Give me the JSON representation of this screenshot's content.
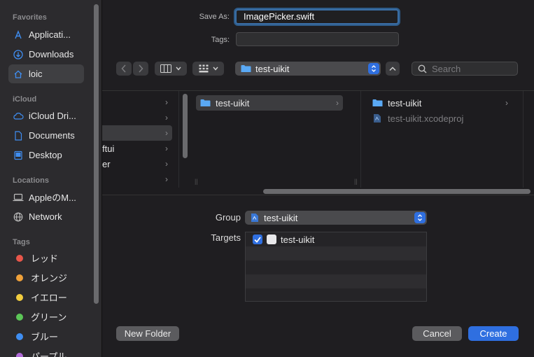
{
  "sidebar": {
    "favorites_heading": "Favorites",
    "favorites": [
      {
        "label": "Applicati...",
        "icon": "applications-icon"
      },
      {
        "label": "Downloads",
        "icon": "downloads-icon"
      },
      {
        "label": "loic",
        "icon": "home-icon",
        "selected": true
      }
    ],
    "icloud_heading": "iCloud",
    "icloud": [
      {
        "label": "iCloud Dri...",
        "icon": "cloud-icon"
      },
      {
        "label": "Documents",
        "icon": "document-icon"
      },
      {
        "label": "Desktop",
        "icon": "desktop-icon"
      }
    ],
    "locations_heading": "Locations",
    "locations": [
      {
        "label": "AppleのM...",
        "icon": "laptop-icon"
      },
      {
        "label": "Network",
        "icon": "network-icon"
      }
    ],
    "tags_heading": "Tags",
    "tags": [
      {
        "label": "レッド",
        "color": "#e8564a"
      },
      {
        "label": "オレンジ",
        "color": "#f0a13a"
      },
      {
        "label": "イエロー",
        "color": "#f3cd3f"
      },
      {
        "label": "グリーン",
        "color": "#5cc657"
      },
      {
        "label": "ブルー",
        "color": "#3f8ef2"
      },
      {
        "label": "パープル",
        "color": "#b06ad8"
      }
    ]
  },
  "form": {
    "save_as_label": "Save As:",
    "save_as_value": "ImagePicker.swift",
    "tags_label": "Tags:",
    "tags_value": ""
  },
  "toolbar": {
    "path_folder": "test-uikit",
    "search_placeholder": "Search"
  },
  "browser": {
    "column1_rows": [
      "",
      "",
      "",
      "ftui",
      "er",
      ""
    ],
    "column2_rows": [
      "test-uikit"
    ],
    "column3_rows": [
      {
        "label": "test-uikit",
        "type": "folder"
      },
      {
        "label": "test-uikit.xcodeproj",
        "type": "project"
      }
    ]
  },
  "options": {
    "group_label": "Group",
    "group_value": "test-uikit",
    "targets_label": "Targets",
    "targets": [
      {
        "label": "test-uikit",
        "checked": true
      }
    ]
  },
  "buttons": {
    "new_folder": "New Folder",
    "cancel": "Cancel",
    "create": "Create"
  },
  "colors": {
    "accent": "#2f6fe0",
    "folder": "#5aa9f5"
  }
}
